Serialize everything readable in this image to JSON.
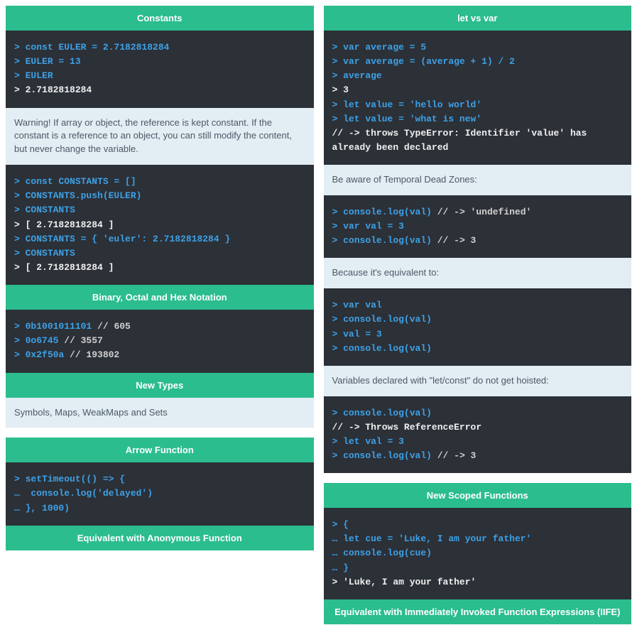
{
  "left": {
    "constants": {
      "title": "Constants",
      "code1": {
        "l1p": "> ",
        "l1": "const EULER = 2.7182818284",
        "l2p": "> ",
        "l2": "EULER = 13",
        "l3p": "> ",
        "l3": "EULER",
        "l4p": "> ",
        "l4": "2.7182818284"
      },
      "warning": "Warning! If array or object, the reference is kept constant. If the constant is a reference to an object, you can still modify the content, but never change the variable.",
      "code2": {
        "l1p": "> ",
        "l1": "const CONSTANTS = []",
        "l2p": "> ",
        "l2": "CONSTANTS.push(EULER)",
        "l3p": "> ",
        "l3": "CONSTANTS",
        "l4p": "> ",
        "l4": "[ 2.7182818284 ]",
        "l5p": "> ",
        "l5": "CONSTANTS = { 'euler': 2.7182818284 }",
        "l6p": "> ",
        "l6": "CONSTANTS",
        "l7p": "> ",
        "l7": "[ 2.7182818284 ]"
      }
    },
    "notation": {
      "title": "Binary, Octal and Hex Notation",
      "code": {
        "l1p": "> ",
        "l1": "0b1001011101",
        "c1": " // 605",
        "l2p": "> ",
        "l2": "0o6745",
        "c2": " // 3557",
        "l3p": "> ",
        "l3": "0x2f50a",
        "c3": " // 193802"
      }
    },
    "newtypes": {
      "title": "New Types",
      "text": "Symbols, Maps, WeakMaps and Sets"
    },
    "arrow": {
      "title": "Arrow Function",
      "code": {
        "l1p": "> ",
        "l1": "setTimeout(() => {",
        "l2p": "…  ",
        "l2": "console.log('delayed')",
        "l3p": "… ",
        "l3": "}, 1000)"
      },
      "sub": "Equivalent with Anonymous Function"
    }
  },
  "right": {
    "letvar": {
      "title": "let vs var",
      "code1": {
        "l1p": "> ",
        "l1": "var average = 5",
        "l2p": "> ",
        "l2": "var average = (average + 1) / 2",
        "l3p": "> ",
        "l3": "average",
        "l4p": "> ",
        "l4": "3",
        "l5p": "> ",
        "l5": "let value = 'hello world'",
        "l6p": "> ",
        "l6": "let value = 'what is new'",
        "l7": "// -> throws TypeError: Identifier 'value' has already been declared"
      },
      "note1": "Be aware of Temporal Dead Zones:",
      "code2": {
        "l1p": "> ",
        "l1": "console.log(val)",
        "c1": " // -> 'undefined'",
        "l2p": "> ",
        "l2": "var val = 3",
        "l3p": "> ",
        "l3": "console.log(val)",
        "c3": " // -> 3"
      },
      "note2": "Because it's equivalent to:",
      "code3": {
        "l1p": "> ",
        "l1": "var val",
        "l2p": "> ",
        "l2": "console.log(val)",
        "l3p": "> ",
        "l3": "val = 3",
        "l4p": "> ",
        "l4": "console.log(val)"
      },
      "note3": "Variables declared with \"let/const\" do not get hoisted:",
      "code4": {
        "l1p": "> ",
        "l1": "console.log(val)",
        "l2": "// -> Throws ReferenceError",
        "l3p": "> ",
        "l3": "let val = 3",
        "l4p": "> ",
        "l4": "console.log(val)",
        "c4": " // -> 3"
      }
    },
    "scoped": {
      "title": "New Scoped Functions",
      "code": {
        "l1p": "> ",
        "l1": "{",
        "l2p": "… ",
        "l2": "let cue = 'Luke, I am your father'",
        "l3p": "… ",
        "l3": "console.log(cue)",
        "l4p": "… ",
        "l4": "}",
        "l5p": "> ",
        "l5": "'Luke, I am your father'"
      },
      "sub": "Equivalent with Immediately Invoked Function Expressions (IIFE)"
    }
  }
}
